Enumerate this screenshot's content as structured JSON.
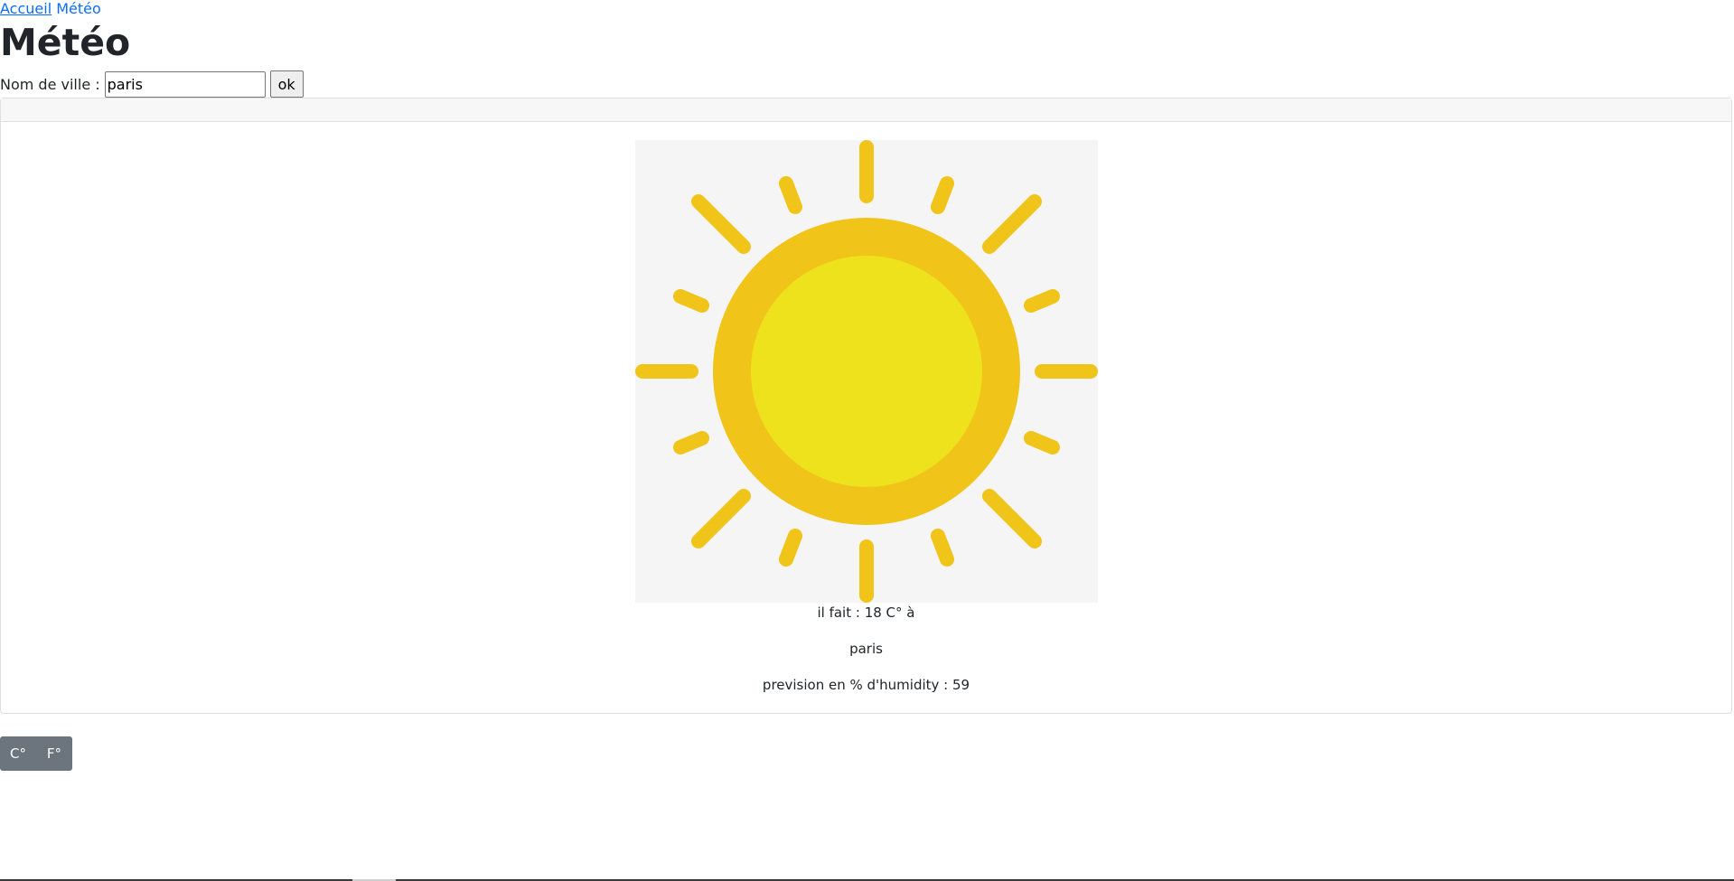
{
  "nav": {
    "home_label": "Accueil",
    "current_label": "Météo"
  },
  "page": {
    "title": "Météo"
  },
  "search": {
    "label": "Nom de ville :",
    "value": "paris",
    "button_label": "ok"
  },
  "weather": {
    "icon": "sun-icon",
    "temperature_text": "il fait : 18 C° à",
    "city": "paris",
    "humidity_text": "prevision en % d'humidity : 59"
  },
  "units": {
    "celsius_label": "C°",
    "fahrenheit_label": "F°"
  },
  "colors": {
    "link": "#0d6efd",
    "sun_outer": "#f0c419",
    "sun_inner": "#ede21b",
    "unit_buttons": "#6c757d"
  }
}
